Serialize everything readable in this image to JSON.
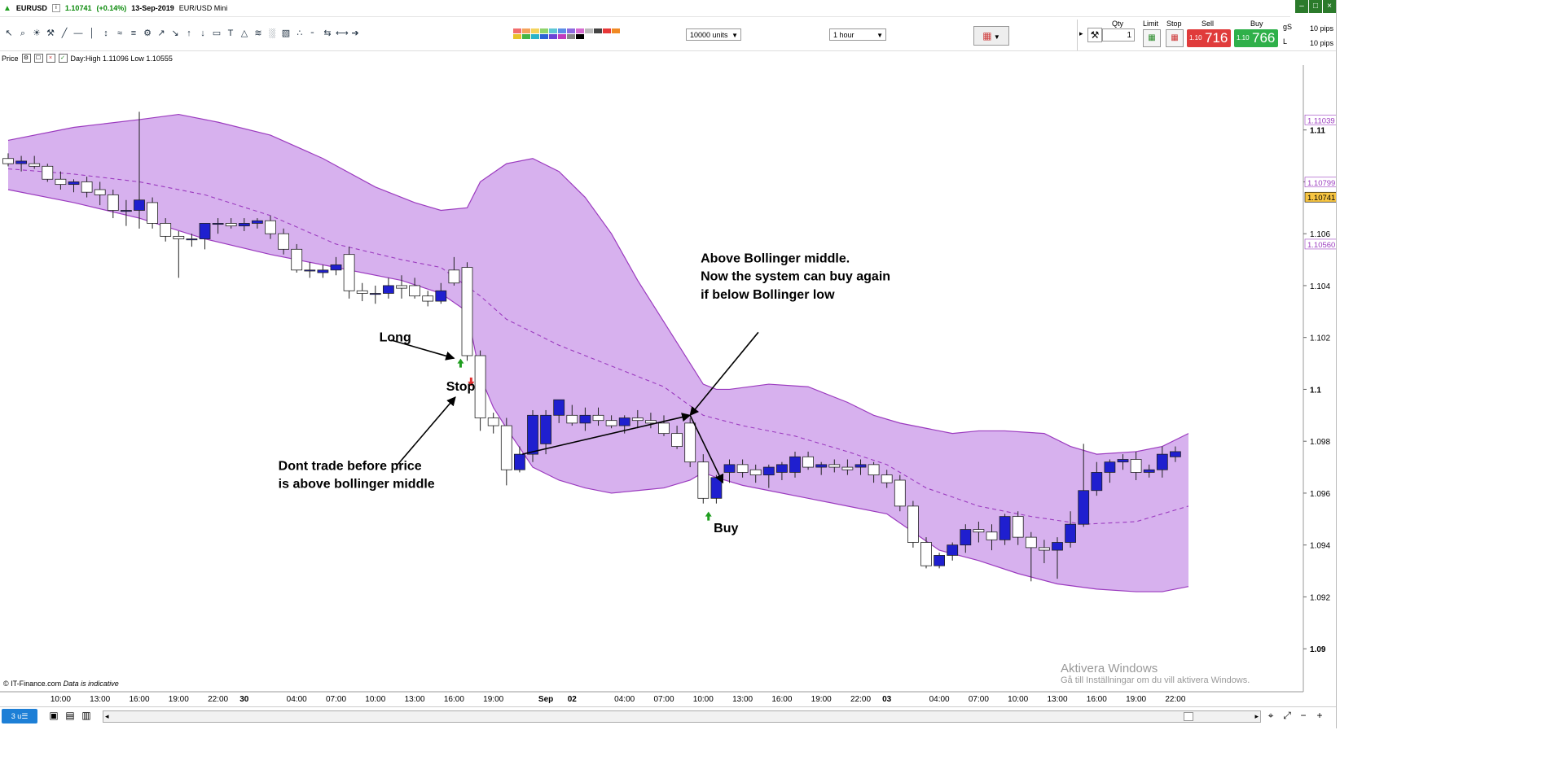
{
  "title": {
    "ticker": "EURUSD",
    "price": "1.10741",
    "change": "(+0.14%)",
    "date": "13-Sep-2019",
    "market": "EUR/USD Mini"
  },
  "window_buttons": [
    "–",
    "□",
    "×"
  ],
  "toolbar": {
    "units_select": "10000 units",
    "interval_select": "1 hour",
    "tool_icons": [
      "↖",
      "⌕",
      "☀",
      "⚒",
      "╱",
      "—",
      "│",
      "↕",
      "≈",
      "≡",
      "⚙",
      "↗",
      "↘",
      "↑",
      "↓",
      "▭",
      "T",
      "△",
      "≋",
      "░",
      "▧",
      "∴",
      "╴",
      "⇆",
      "⟷",
      "➔"
    ],
    "swatch_colors": [
      "#f26d6d",
      "#f5a25a",
      "#f3d35c",
      "#8fd36b",
      "#5ec7d6",
      "#5b8de8",
      "#8d6ae0",
      "#d66bd0",
      "#bbbbbb",
      "#444444",
      "#e83838",
      "#f08a24",
      "#e8c32a",
      "#45b545",
      "#2bb3c9",
      "#2b62d6",
      "#6b45d6",
      "#c23bbd",
      "#888888",
      "#000000"
    ],
    "chart_type_icon": "▦"
  },
  "ticket": {
    "qty_label": "Qty",
    "qty_value": "1",
    "limit_label": "Limit",
    "stop_label": "Stop",
    "sell_label": "Sell",
    "buy_label": "Buy",
    "sell_small": "1.10",
    "sell_big": "716",
    "buy_small": "1.10",
    "buy_big": "766",
    "pips_top": "10 pips",
    "pips_bottom": "10 pips",
    "side_g": "gS",
    "side_l": "L"
  },
  "infobar": {
    "label": "Price",
    "stats": "Day:High 1.11096  Low 1.10555"
  },
  "chart_data": {
    "type": "candlestick",
    "title": "",
    "instrument": "EURUSD",
    "timeframe": "1 hour",
    "ylim": [
      1.0885,
      1.1125
    ],
    "y_ticks": [
      "1.11",
      "1.108",
      "1.106",
      "1.104",
      "1.102",
      "1.1",
      "1.098",
      "1.096",
      "1.094",
      "1.092",
      "1.09"
    ],
    "y_tick_values": [
      1.11,
      1.108,
      1.106,
      1.104,
      1.102,
      1.1,
      1.098,
      1.096,
      1.094,
      1.092,
      1.09
    ],
    "price_tags": [
      {
        "label": "1.11039",
        "value": 1.11039,
        "bg": "#ffffff",
        "color": "#9b3bbf"
      },
      {
        "label": "1.10799",
        "value": 1.10799,
        "bg": "#ffffff",
        "color": "#9b3bbf"
      },
      {
        "label": "1.10741",
        "value": 1.10741,
        "bg": "#f7c542",
        "color": "#000000"
      },
      {
        "label": "1.10560",
        "value": 1.1056,
        "bg": "#ffffff",
        "color": "#9b3bbf"
      }
    ],
    "x_tick_labels": [
      {
        "i": 4,
        "t": "10:00"
      },
      {
        "i": 7,
        "t": "13:00"
      },
      {
        "i": 10,
        "t": "16:00"
      },
      {
        "i": 13,
        "t": "19:00"
      },
      {
        "i": 16,
        "t": "22:00"
      },
      {
        "i": 18,
        "t": "30"
      },
      {
        "i": 22,
        "t": "04:00"
      },
      {
        "i": 25,
        "t": "07:00"
      },
      {
        "i": 28,
        "t": "10:00"
      },
      {
        "i": 31,
        "t": "13:00"
      },
      {
        "i": 34,
        "t": "16:00"
      },
      {
        "i": 37,
        "t": "19:00"
      },
      {
        "i": 41,
        "t": "Sep"
      },
      {
        "i": 43,
        "t": "02"
      },
      {
        "i": 47,
        "t": "04:00"
      },
      {
        "i": 50,
        "t": "07:00"
      },
      {
        "i": 53,
        "t": "10:00"
      },
      {
        "i": 56,
        "t": "13:00"
      },
      {
        "i": 59,
        "t": "16:00"
      },
      {
        "i": 62,
        "t": "19:00"
      },
      {
        "i": 65,
        "t": "22:00"
      },
      {
        "i": 67,
        "t": "03"
      },
      {
        "i": 71,
        "t": "04:00"
      },
      {
        "i": 74,
        "t": "07:00"
      },
      {
        "i": 77,
        "t": "10:00"
      },
      {
        "i": 80,
        "t": "13:00"
      },
      {
        "i": 83,
        "t": "16:00"
      },
      {
        "i": 86,
        "t": "19:00"
      },
      {
        "i": 89,
        "t": "22:00"
      }
    ],
    "candles": [
      [
        1.1089,
        1.1091,
        1.1086,
        1.1087
      ],
      [
        1.1087,
        1.109,
        1.1084,
        1.1088
      ],
      [
        1.1087,
        1.109,
        1.1085,
        1.1086
      ],
      [
        1.1086,
        1.1087,
        1.108,
        1.1081
      ],
      [
        1.1081,
        1.1084,
        1.1077,
        1.1079
      ],
      [
        1.1079,
        1.1081,
        1.1076,
        1.108
      ],
      [
        1.108,
        1.1082,
        1.1074,
        1.1076
      ],
      [
        1.1077,
        1.108,
        1.1071,
        1.1075
      ],
      [
        1.1075,
        1.1077,
        1.1066,
        1.1069
      ],
      [
        1.1069,
        1.1073,
        1.1063,
        1.1069
      ],
      [
        1.1069,
        1.1107,
        1.1062,
        1.1073
      ],
      [
        1.1072,
        1.1074,
        1.1062,
        1.1064
      ],
      [
        1.1064,
        1.1066,
        1.1057,
        1.1059
      ],
      [
        1.1059,
        1.1061,
        1.1043,
        1.1058
      ],
      [
        1.1058,
        1.106,
        1.1055,
        1.1058
      ],
      [
        1.1058,
        1.1064,
        1.1054,
        1.1064
      ],
      [
        1.1064,
        1.1066,
        1.106,
        1.1064
      ],
      [
        1.1064,
        1.1066,
        1.1062,
        1.1063
      ],
      [
        1.1063,
        1.1066,
        1.1061,
        1.1064
      ],
      [
        1.1064,
        1.1066,
        1.1062,
        1.1065
      ],
      [
        1.1065,
        1.1067,
        1.1058,
        1.106
      ],
      [
        1.106,
        1.1062,
        1.1052,
        1.1054
      ],
      [
        1.1054,
        1.1056,
        1.1045,
        1.1046
      ],
      [
        1.1046,
        1.1049,
        1.1043,
        1.1046
      ],
      [
        1.1045,
        1.1048,
        1.1043,
        1.1046
      ],
      [
        1.1046,
        1.1051,
        1.1044,
        1.1048
      ],
      [
        1.1052,
        1.1055,
        1.1035,
        1.1038
      ],
      [
        1.1038,
        1.1041,
        1.1034,
        1.1037
      ],
      [
        1.1037,
        1.104,
        1.1033,
        1.1037
      ],
      [
        1.1037,
        1.1043,
        1.1035,
        1.104
      ],
      [
        1.104,
        1.1044,
        1.1035,
        1.1039
      ],
      [
        1.104,
        1.1043,
        1.1035,
        1.1036
      ],
      [
        1.1036,
        1.1038,
        1.1032,
        1.1034
      ],
      [
        1.1034,
        1.1041,
        1.1033,
        1.1038
      ],
      [
        1.1046,
        1.1051,
        1.104,
        1.1041
      ],
      [
        1.1047,
        1.1049,
        1.1011,
        1.1013
      ],
      [
        1.1013,
        1.1015,
        1.0984,
        1.0989
      ],
      [
        1.0989,
        1.0991,
        1.0983,
        1.0986
      ],
      [
        1.0986,
        1.0989,
        1.0963,
        1.0969
      ],
      [
        1.0969,
        1.0978,
        1.0968,
        1.0975
      ],
      [
        1.0975,
        1.0992,
        1.0972,
        1.099
      ],
      [
        1.0979,
        1.0992,
        1.0975,
        1.099
      ],
      [
        1.099,
        1.0996,
        1.0987,
        1.0996
      ],
      [
        1.099,
        1.0994,
        1.0986,
        1.0987
      ],
      [
        1.0987,
        1.0993,
        1.0984,
        1.099
      ],
      [
        1.099,
        1.0993,
        1.0986,
        1.0988
      ],
      [
        1.0988,
        1.099,
        1.0985,
        1.0986
      ],
      [
        1.0986,
        1.099,
        1.0983,
        1.0989
      ],
      [
        1.0989,
        1.0992,
        1.0985,
        1.0988
      ],
      [
        1.0988,
        1.0991,
        1.0985,
        1.0987
      ],
      [
        1.0987,
        1.099,
        1.0982,
        1.0983
      ],
      [
        1.0983,
        1.0986,
        1.0977,
        1.0978
      ],
      [
        1.0987,
        1.0989,
        1.097,
        1.0972
      ],
      [
        1.0972,
        1.0975,
        1.0956,
        1.0958
      ],
      [
        1.0958,
        1.0967,
        1.0956,
        1.0966
      ],
      [
        1.0968,
        1.0973,
        1.0964,
        1.0971
      ],
      [
        1.0971,
        1.0973,
        1.0966,
        1.0968
      ],
      [
        1.0969,
        1.0971,
        1.0964,
        1.0967
      ],
      [
        1.0967,
        1.0971,
        1.0962,
        1.097
      ],
      [
        1.0968,
        1.0972,
        1.0965,
        1.0971
      ],
      [
        1.0968,
        1.0976,
        1.0966,
        1.0974
      ],
      [
        1.0974,
        1.0976,
        1.0969,
        1.097
      ],
      [
        1.097,
        1.0972,
        1.0967,
        1.0971
      ],
      [
        1.0971,
        1.0973,
        1.0968,
        1.097
      ],
      [
        1.097,
        1.0973,
        1.0967,
        1.0969
      ],
      [
        1.097,
        1.0973,
        1.0967,
        1.0971
      ],
      [
        1.0971,
        1.0972,
        1.0964,
        1.0967
      ],
      [
        1.0967,
        1.0969,
        1.0962,
        1.0964
      ],
      [
        1.0965,
        1.0967,
        1.0953,
        1.0955
      ],
      [
        1.0955,
        1.0957,
        1.0939,
        1.0941
      ],
      [
        1.0941,
        1.0943,
        1.0931,
        1.0932
      ],
      [
        1.0932,
        1.0937,
        1.0931,
        1.0936
      ],
      [
        1.0936,
        1.0941,
        1.0934,
        1.094
      ],
      [
        1.094,
        1.0948,
        1.0937,
        1.0946
      ],
      [
        1.0946,
        1.0949,
        1.0941,
        1.0945
      ],
      [
        1.0945,
        1.0948,
        1.0938,
        1.0942
      ],
      [
        1.0942,
        1.0952,
        1.094,
        1.0951
      ],
      [
        1.0951,
        1.0953,
        1.094,
        1.0943
      ],
      [
        1.0943,
        1.0945,
        1.0926,
        1.0939
      ],
      [
        1.0939,
        1.0942,
        1.0933,
        1.0938
      ],
      [
        1.0938,
        1.0943,
        1.0927,
        1.0941
      ],
      [
        1.0941,
        1.0953,
        1.0939,
        1.0948
      ],
      [
        1.0948,
        1.0979,
        1.0947,
        1.0961
      ],
      [
        1.0961,
        1.0972,
        1.0959,
        1.0968
      ],
      [
        1.0968,
        1.0973,
        1.0964,
        1.0972
      ],
      [
        1.0972,
        1.0975,
        1.0969,
        1.0973
      ],
      [
        1.0973,
        1.0976,
        1.0965,
        1.0968
      ],
      [
        1.0968,
        1.0971,
        1.0966,
        1.0969
      ],
      [
        1.0969,
        1.0978,
        1.0966,
        1.0975
      ],
      [
        1.0974,
        1.0978,
        1.0972,
        1.0976
      ]
    ],
    "candle_colors": {
      "up": "#1f1fcf",
      "down": "#ffffff",
      "outline": "#222222"
    },
    "bollinger": {
      "fill": "#d7b1ee",
      "edge": "#9b3bbf",
      "upper": [
        [
          0,
          1.1096
        ],
        [
          5,
          1.1101
        ],
        [
          10,
          1.1104
        ],
        [
          13,
          1.1106
        ],
        [
          16,
          1.1103
        ],
        [
          20,
          1.1098
        ],
        [
          24,
          1.1089
        ],
        [
          28,
          1.1078
        ],
        [
          31,
          1.1072
        ],
        [
          33,
          1.1069
        ],
        [
          35,
          1.107
        ],
        [
          36,
          1.108
        ],
        [
          38,
          1.1087
        ],
        [
          40,
          1.1089
        ],
        [
          42,
          1.1084
        ],
        [
          44,
          1.1074
        ],
        [
          46,
          1.106
        ],
        [
          48,
          1.1042
        ],
        [
          50,
          1.1026
        ],
        [
          52,
          1.101
        ],
        [
          53,
          1.1002
        ],
        [
          54,
          1.1
        ],
        [
          55,
          1.1
        ],
        [
          58,
          1.1002
        ],
        [
          61,
          1.1001
        ],
        [
          64,
          1.0995
        ],
        [
          66,
          1.099
        ],
        [
          68,
          1.0987
        ],
        [
          70,
          1.0985
        ],
        [
          72,
          1.0983
        ],
        [
          74,
          1.0984
        ],
        [
          76,
          1.0984
        ],
        [
          79,
          1.0983
        ],
        [
          81,
          1.0978
        ],
        [
          83,
          1.0975
        ],
        [
          86,
          1.0976
        ],
        [
          88,
          1.0978
        ],
        [
          90,
          1.0983
        ]
      ],
      "middle": [
        [
          0,
          1.1085
        ],
        [
          5,
          1.1083
        ],
        [
          10,
          1.108
        ],
        [
          15,
          1.1075
        ],
        [
          20,
          1.1067
        ],
        [
          25,
          1.1056
        ],
        [
          30,
          1.105
        ],
        [
          33,
          1.1047
        ],
        [
          36,
          1.1036
        ],
        [
          38,
          1.1027
        ],
        [
          42,
          1.1017
        ],
        [
          46,
          1.1009
        ],
        [
          50,
          1.1001
        ],
        [
          53,
          1.099
        ],
        [
          56,
          1.0986
        ],
        [
          60,
          1.0982
        ],
        [
          64,
          1.0976
        ],
        [
          67,
          1.0971
        ],
        [
          70,
          1.0962
        ],
        [
          74,
          1.0955
        ],
        [
          78,
          1.0951
        ],
        [
          82,
          1.0948
        ],
        [
          86,
          1.0949
        ],
        [
          90,
          1.0955
        ]
      ],
      "lower": [
        [
          0,
          1.1077
        ],
        [
          5,
          1.1072
        ],
        [
          10,
          1.1066
        ],
        [
          15,
          1.1058
        ],
        [
          20,
          1.1052
        ],
        [
          25,
          1.1047
        ],
        [
          30,
          1.1042
        ],
        [
          33,
          1.1037
        ],
        [
          35,
          1.103
        ],
        [
          36,
          1.1005
        ],
        [
          37,
          1.0993
        ],
        [
          38,
          1.0985
        ],
        [
          40,
          1.097
        ],
        [
          42,
          1.0965
        ],
        [
          44,
          1.0962
        ],
        [
          46,
          1.096
        ],
        [
          48,
          1.0961
        ],
        [
          50,
          1.0962
        ],
        [
          52,
          1.0965
        ],
        [
          53,
          1.0968
        ],
        [
          54,
          1.0966
        ],
        [
          56,
          1.0963
        ],
        [
          58,
          1.0961
        ],
        [
          61,
          1.0958
        ],
        [
          64,
          1.0955
        ],
        [
          67,
          1.0952
        ],
        [
          69,
          1.0945
        ],
        [
          71,
          1.0938
        ],
        [
          74,
          1.0934
        ],
        [
          77,
          1.0929
        ],
        [
          80,
          1.0925
        ],
        [
          83,
          1.0923
        ],
        [
          86,
          1.0922
        ],
        [
          88,
          1.0922
        ],
        [
          90,
          1.0924
        ]
      ]
    },
    "signals": [
      {
        "type": "buy-arrow",
        "i": 34.5,
        "price": 1.101,
        "color": "#1f9e1f"
      },
      {
        "type": "sell-arrow",
        "i": 35.3,
        "price": 1.1003,
        "color": "#e03030"
      },
      {
        "type": "buy-arrow",
        "i": 53.4,
        "price": 1.0951,
        "color": "#1f9e1f"
      }
    ],
    "annotations": [
      {
        "id": "long",
        "text": "Long",
        "i": 28.3,
        "price": 1.10185
      },
      {
        "id": "stop",
        "text": "Stop",
        "i": 33.4,
        "price": 1.09995
      },
      {
        "id": "buy",
        "text": "Buy",
        "i": 53.8,
        "price": 1.0945
      },
      {
        "id": "dont1",
        "text": "Dont trade before price",
        "i": 20.6,
        "price": 1.0969
      },
      {
        "id": "dont2",
        "text": "is above bollinger middle",
        "i": 20.6,
        "price": 1.0962
      },
      {
        "id": "above1",
        "text": "Above Bollinger middle.",
        "i": 52.8,
        "price": 1.1049
      },
      {
        "id": "above2",
        "text": "Now the system can buy again",
        "i": 52.8,
        "price": 1.1042
      },
      {
        "id": "above3",
        "text": " if below Bollinger low",
        "i": 52.8,
        "price": 1.1035
      }
    ],
    "arrows": [
      {
        "from": [
          29.2,
          1.1019
        ],
        "to": [
          34.0,
          1.1012
        ]
      },
      {
        "from": [
          29.7,
          1.0971
        ],
        "to": [
          34.1,
          1.0997
        ]
      },
      {
        "from": [
          39.2,
          1.0975
        ],
        "to": [
          52.0,
          1.099
        ]
      },
      {
        "from": [
          57.2,
          1.1022
        ],
        "to": [
          52.0,
          1.099
        ]
      },
      {
        "from": [
          52.0,
          1.099
        ],
        "to": [
          54.5,
          1.0964
        ]
      }
    ]
  },
  "watermark": {
    "line1": "Aktivera Windows",
    "line2": "Gå till Inställningar om du vill aktivera Windows."
  },
  "copyright": {
    "brand": "© IT-Finance.com",
    "note": "Data is indicative"
  },
  "footer": {
    "main_button": "3 u☰",
    "icons": [
      "▣",
      "▤",
      "▥"
    ],
    "zoom_icons": [
      "⌖",
      "⤢",
      "−",
      "+"
    ]
  }
}
